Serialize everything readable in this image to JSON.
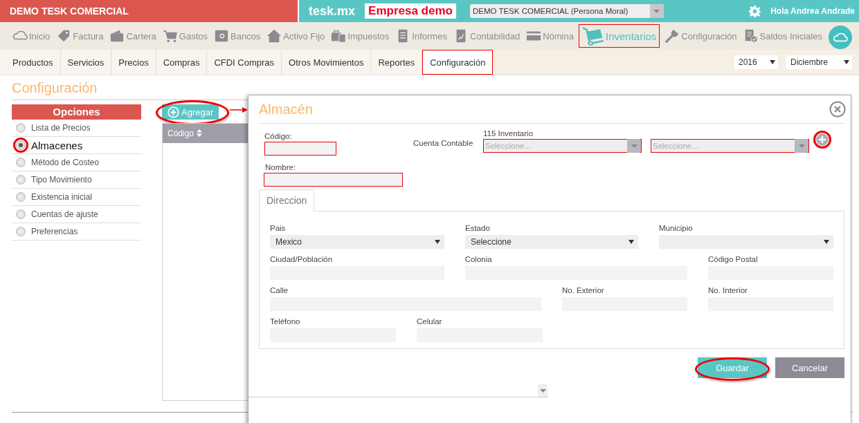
{
  "header": {
    "company_title": "DEMO TESK COMERCIAL",
    "brand": "tesk.mx",
    "company_badge": "Empresa demo",
    "company_select": "DEMO TESK COMERCIAL (Persona Moral)",
    "user_greeting": "Hola Andrea Andrade"
  },
  "main_nav": [
    {
      "label": "Inicio",
      "selected": false
    },
    {
      "label": "Factura",
      "selected": false
    },
    {
      "label": "Cartera",
      "selected": false
    },
    {
      "label": "Gastos",
      "selected": false
    },
    {
      "label": "Bancos",
      "selected": false
    },
    {
      "label": "Activo Fijo",
      "selected": false
    },
    {
      "label": "Impuestos",
      "selected": false
    },
    {
      "label": "Informes",
      "selected": false
    },
    {
      "label": "Contabilidad",
      "selected": false
    },
    {
      "label": "Nómina",
      "selected": false
    },
    {
      "label": "Inventarios",
      "selected": true
    },
    {
      "label": "Configuración",
      "selected": false
    },
    {
      "label": "Saldos Iniciales",
      "selected": false
    }
  ],
  "sub_nav": [
    {
      "label": "Productos",
      "selected": false
    },
    {
      "label": "Servicios",
      "selected": false
    },
    {
      "label": "Precios",
      "selected": false
    },
    {
      "label": "Compras",
      "selected": false
    },
    {
      "label": "CFDI Compras",
      "selected": false
    },
    {
      "label": "Otros Movimientos",
      "selected": false
    },
    {
      "label": "Reportes",
      "selected": false
    },
    {
      "label": "Configuración",
      "selected": true
    }
  ],
  "period": {
    "year": "2016",
    "month": "Diciembre"
  },
  "page_title": "Configuración",
  "options": {
    "title": "Opciones",
    "items": [
      {
        "label": "Lista de Precios",
        "selected": false
      },
      {
        "label": "Almacenes",
        "selected": true
      },
      {
        "label": "Método de Costeo",
        "selected": false
      },
      {
        "label": "Tipo Movimiento",
        "selected": false
      },
      {
        "label": "Existencia inicial",
        "selected": false
      },
      {
        "label": "Cuentas de ajuste",
        "selected": false
      },
      {
        "label": "Preferencias",
        "selected": false
      }
    ]
  },
  "add_button": {
    "label": "Agregar",
    "annotated": true
  },
  "table": {
    "columns": [
      "Código"
    ]
  },
  "dialog": {
    "title": "Almacén",
    "code": {
      "label": "Código:",
      "highlighted": true
    },
    "account_label": "Cuenta Contable",
    "account_caption": "115 Inventario",
    "account_selects": [
      {
        "placeholder": "Seleccione...",
        "highlighted": true
      },
      {
        "placeholder": "Seleccione...",
        "highlighted": true
      }
    ],
    "add_account_button": {
      "annotated": true
    },
    "name": {
      "label": "Nombre:",
      "highlighted": true
    },
    "tab": "Direccion",
    "address_rows": [
      [
        {
          "label": "Pais",
          "kind": "select",
          "value": "Mexico"
        },
        {
          "label": "Estado",
          "kind": "select",
          "value": "Seleccione"
        },
        {
          "label": "Municipio",
          "kind": "select"
        }
      ],
      [
        {
          "label": "Ciudad/Población",
          "kind": "text"
        },
        {
          "label": "Colonia",
          "kind": "text"
        },
        {
          "label": "Código Postal",
          "kind": "text"
        }
      ],
      [
        {
          "label": "Calle",
          "kind": "text"
        },
        {
          "label": "No. Exterior",
          "kind": "text"
        },
        {
          "label": "No. Interior",
          "kind": "text"
        }
      ],
      [
        {
          "label": "Teléfono",
          "kind": "text"
        },
        {
          "label": "Celular",
          "kind": "text"
        }
      ]
    ],
    "buttons": [
      {
        "label": "Guardar",
        "kind": "primary",
        "annotated": true
      },
      {
        "label": "Cancelar",
        "kind": "secondary",
        "annotated": false
      }
    ]
  }
}
